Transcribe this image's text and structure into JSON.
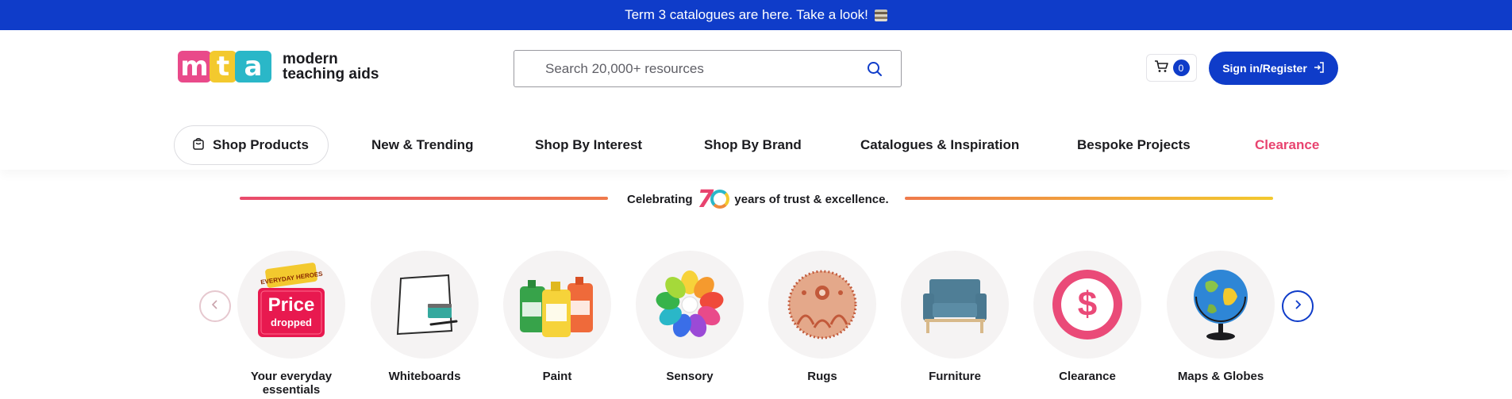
{
  "announcement": {
    "text": "Term 3 catalogues are here. Take a look!",
    "icon": "books-icon"
  },
  "header": {
    "logo": {
      "letters": [
        "m",
        "t",
        "a"
      ],
      "text_line1": "modern",
      "text_line2": "teaching aids"
    },
    "search": {
      "placeholder": "Search 20,000+ resources",
      "value": ""
    },
    "cart": {
      "count": "0"
    },
    "signin_label": "Sign in/Register"
  },
  "nav": {
    "items": [
      {
        "label": "Shop Products",
        "icon": "shopping-bag-icon"
      },
      {
        "label": "New & Trending"
      },
      {
        "label": "Shop By Interest"
      },
      {
        "label": "Shop By Brand"
      },
      {
        "label": "Catalogues & Inspiration"
      },
      {
        "label": "Bespoke Projects"
      },
      {
        "label": "Clearance"
      }
    ]
  },
  "celebrate": {
    "prefix": "Celebrating",
    "number_seven": "7",
    "suffix": "years of trust & excellence."
  },
  "categories": [
    {
      "label": "Your everyday essentials",
      "badge_top": "EVERYDAY HEROES",
      "badge_main": "Price",
      "badge_sub": "dropped"
    },
    {
      "label": "Whiteboards"
    },
    {
      "label": "Paint"
    },
    {
      "label": "Sensory"
    },
    {
      "label": "Rugs"
    },
    {
      "label": "Furniture"
    },
    {
      "label": "Clearance",
      "symbol": "$"
    },
    {
      "label": "Maps & Globes"
    }
  ],
  "colors": {
    "brand_blue": "#0f3cc9",
    "clearance_pink": "#e8436f",
    "logo_pink": "#e94a8a",
    "logo_yellow": "#f3c92e",
    "logo_teal": "#2ab7c8"
  }
}
